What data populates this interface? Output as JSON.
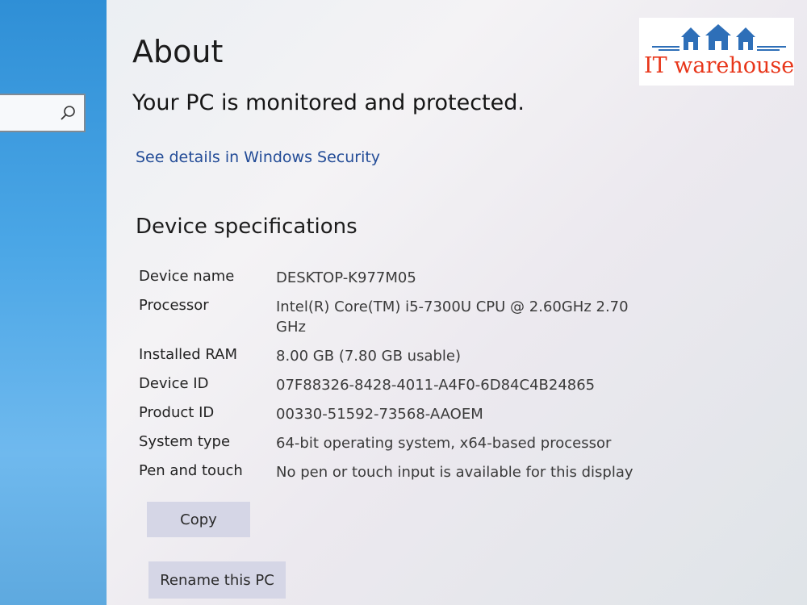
{
  "sidebar": {
    "search": {
      "icon": "search-icon"
    }
  },
  "header": {
    "title": "About",
    "status": "Your PC is monitored and protected.",
    "security_link": "See details in Windows Security"
  },
  "specs": {
    "title": "Device specifications",
    "rows": [
      {
        "label": "Device name",
        "value": "DESKTOP-K977M05"
      },
      {
        "label": "Processor",
        "value": "Intel(R) Core(TM) i5-7300U CPU @ 2.60GHz   2.70 GHz"
      },
      {
        "label": "Installed RAM",
        "value": "8.00 GB (7.80 GB usable)"
      },
      {
        "label": "Device ID",
        "value": "07F88326-8428-4011-A4F0-6D84C4B24865"
      },
      {
        "label": "Product ID",
        "value": "00330-51592-73568-AAOEM"
      },
      {
        "label": "System type",
        "value": "64-bit operating system, x64-based processor"
      },
      {
        "label": "Pen and touch",
        "value": "No pen or touch input is available for this display"
      }
    ]
  },
  "actions": {
    "copy_label": "Copy",
    "rename_label": "Rename this PC"
  },
  "watermark": {
    "text": "IT warehouse",
    "icon": "house-logo-icon",
    "colors": {
      "text": "#e8361a",
      "houses": "#2e6fb8"
    }
  }
}
